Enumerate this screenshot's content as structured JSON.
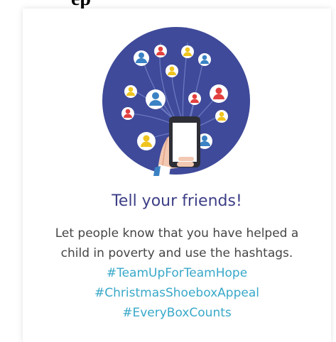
{
  "top_text": "ep",
  "card": {
    "title": "Tell your friends!",
    "body_line1": "Let people know that you have helped a",
    "body_line2": "child in poverty and use the hashtags.",
    "hashtags": [
      "#TeamUpForTeamHope",
      "#ChristmasShoeboxAppeal",
      "#EveryBoxCounts"
    ]
  },
  "colors": {
    "circle": "#3f4a9a",
    "title": "#3d3f86",
    "hashtag": "#38a8c9",
    "person_blue": "#3b82c4",
    "person_red": "#e2403f",
    "person_yellow": "#f0c41f"
  },
  "icons": [
    "people-network-icon",
    "phone-in-hand-icon"
  ]
}
